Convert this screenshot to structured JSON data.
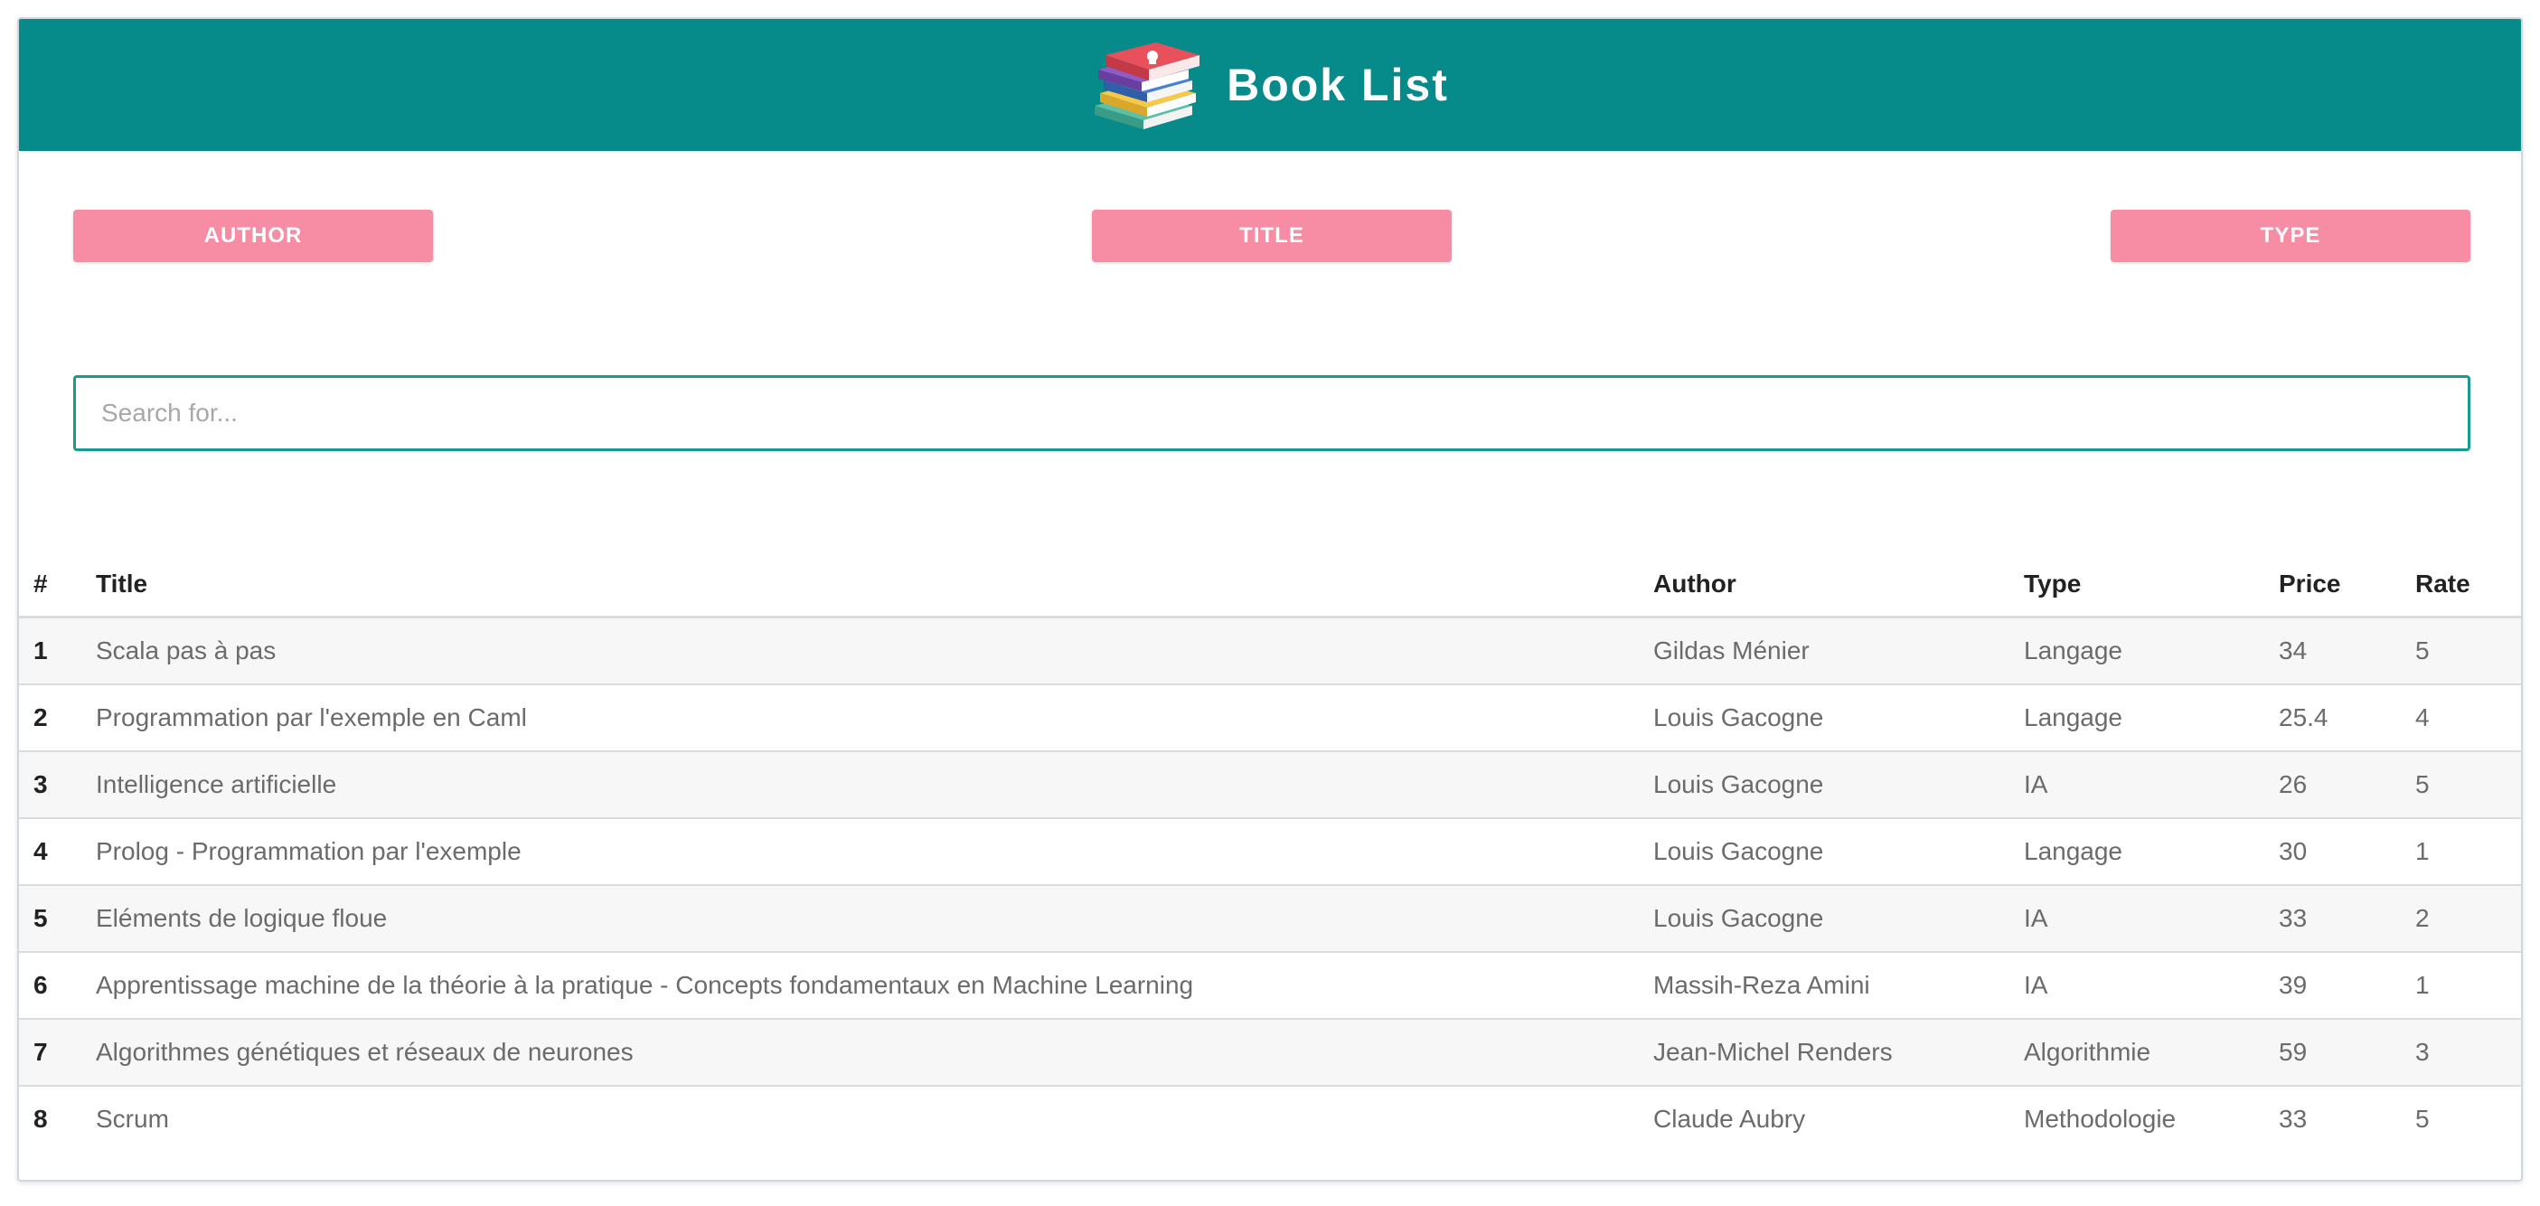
{
  "header": {
    "title": "Book List",
    "logo_icon": "books-stack-icon",
    "background_color": "#078a8a"
  },
  "filters": {
    "author_label": "Author",
    "title_label": "Title",
    "type_label": "Type",
    "button_color": "#f78da4"
  },
  "search": {
    "placeholder": "Search for...",
    "value": ""
  },
  "table": {
    "columns": [
      "#",
      "Title",
      "Author",
      "Type",
      "Price",
      "Rate"
    ],
    "rows": [
      {
        "num": "1",
        "title": "Scala pas à pas",
        "author": "Gildas Ménier",
        "type": "Langage",
        "price": "34",
        "rate": "5"
      },
      {
        "num": "2",
        "title": "Programmation par l'exemple en Caml",
        "author": "Louis Gacogne",
        "type": "Langage",
        "price": "25.4",
        "rate": "4"
      },
      {
        "num": "3",
        "title": "Intelligence artificielle",
        "author": "Louis Gacogne",
        "type": "IA",
        "price": "26",
        "rate": "5"
      },
      {
        "num": "4",
        "title": "Prolog - Programmation par l'exemple",
        "author": "Louis Gacogne",
        "type": "Langage",
        "price": "30",
        "rate": "1"
      },
      {
        "num": "5",
        "title": "Eléments de logique floue",
        "author": "Louis Gacogne",
        "type": "IA",
        "price": "33",
        "rate": "2"
      },
      {
        "num": "6",
        "title": "Apprentissage machine de la théorie à la pratique - Concepts fondamentaux en Machine Learning",
        "author": "Massih-Reza Amini",
        "type": "IA",
        "price": "39",
        "rate": "1"
      },
      {
        "num": "7",
        "title": "Algorithmes génétiques et réseaux de neurones",
        "author": "Jean-Michel Renders",
        "type": "Algorithmie",
        "price": "59",
        "rate": "3"
      },
      {
        "num": "8",
        "title": "Scrum",
        "author": "Claude Aubry",
        "type": "Methodologie",
        "price": "33",
        "rate": "5"
      }
    ]
  }
}
